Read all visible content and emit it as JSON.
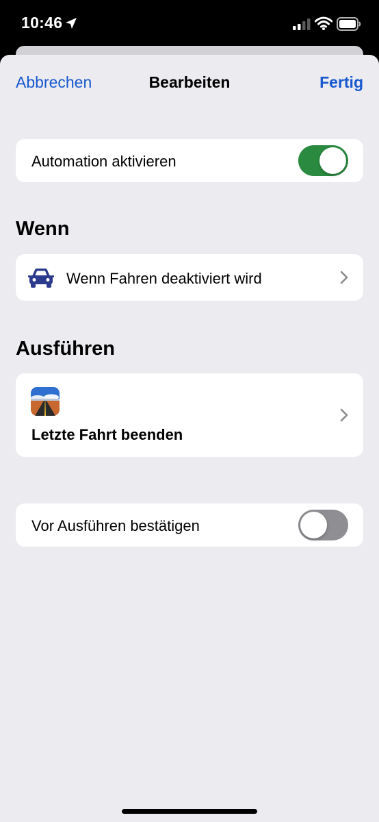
{
  "status_bar": {
    "time": "10:46",
    "location_icon": "location-arrow-icon",
    "signal_icon": "cellular-signal-icon",
    "wifi_icon": "wifi-icon",
    "battery_icon": "battery-icon"
  },
  "nav": {
    "cancel_label": "Abbrechen",
    "title": "Bearbeiten",
    "done_label": "Fertig"
  },
  "enable_automation": {
    "label": "Automation aktivieren",
    "on": true
  },
  "when_section": {
    "title": "Wenn",
    "trigger_icon": "car-icon",
    "trigger_label": "Wenn Fahren deaktiviert wird"
  },
  "run_section": {
    "title": "Ausführen",
    "shortcut_icon": "road-image-icon",
    "shortcut_label": "Letzte Fahrt beenden"
  },
  "confirm_before_run": {
    "label": "Vor Ausführen bestätigen",
    "on": false
  },
  "colors": {
    "accent": "#1658cf",
    "toggle_on": "#2a8a3f",
    "toggle_off": "#8e8e93",
    "background": "#ebebf0",
    "car_icon": "#2b3a8c"
  }
}
